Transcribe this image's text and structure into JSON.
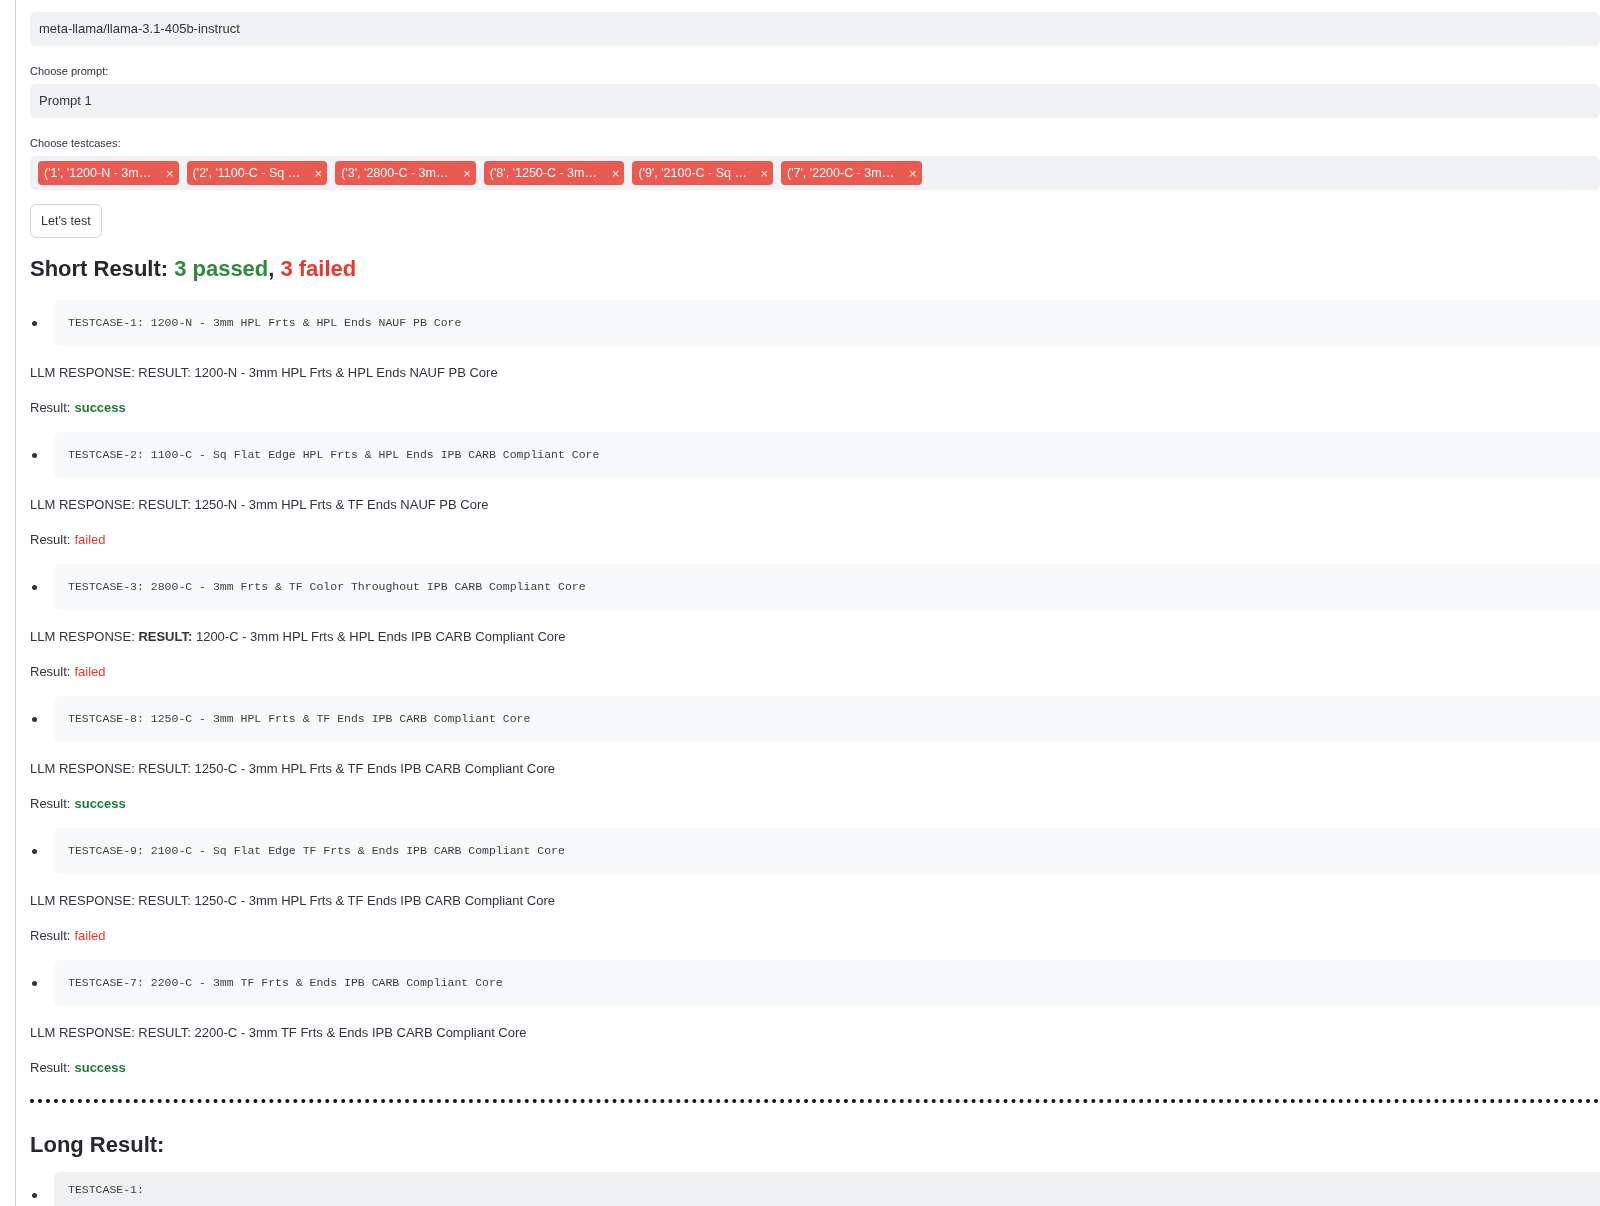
{
  "model_select": {
    "value": "meta-llama/llama-3.1-405b-instruct"
  },
  "prompt_select": {
    "label": "Choose prompt:",
    "value": "Prompt 1"
  },
  "testcase_select": {
    "label": "Choose testcases:",
    "chips": [
      {
        "label": "('1', '1200-N - 3m…",
        "remove": "×"
      },
      {
        "label": "('2', '1100-C - Sq …",
        "remove": "×"
      },
      {
        "label": "('3', '2800-C - 3m…",
        "remove": "×"
      },
      {
        "label": "('8', '1250-C - 3m…",
        "remove": "×"
      },
      {
        "label": "('9', '2100-C - Sq …",
        "remove": "×"
      },
      {
        "label": "('7', '2200-C - 3m…",
        "remove": "×"
      }
    ]
  },
  "run_button": "Let's test",
  "short_result": {
    "title": "Short Result:",
    "passed": "3 passed",
    "separator": ",",
    "failed": "3 failed"
  },
  "results": [
    {
      "testcase": "TESTCASE-1: 1200-N - 3mm HPL Frts & HPL Ends NAUF PB Core",
      "response": "LLM RESPONSE: RESULT: 1200-N - 3mm HPL Frts & HPL Ends NAUF PB Core",
      "result_label": "Result:",
      "result": "success",
      "kind": "success"
    },
    {
      "testcase": "TESTCASE-2: 1100-C - Sq Flat Edge HPL Frts & HPL Ends IPB CARB Compliant Core",
      "response": "LLM RESPONSE: RESULT: 1250-N - 3mm HPL Frts & TF Ends NAUF PB Core",
      "result_label": "Result:",
      "result": "failed",
      "kind": "failed"
    },
    {
      "testcase": "TESTCASE-3: 2800-C - 3mm Frts & TF Color Throughout IPB CARB Compliant Core",
      "response": "LLM RESPONSE: **RESULT:** 1200-C - 3mm HPL Frts & HPL Ends IPB CARB Compliant Core",
      "result_label": "Result:",
      "result": "failed",
      "kind": "failed"
    },
    {
      "testcase": "TESTCASE-8: 1250-C - 3mm HPL Frts & TF Ends IPB CARB Compliant Core",
      "response": "LLM RESPONSE: RESULT: 1250-C - 3mm HPL Frts & TF Ends IPB CARB Compliant Core",
      "result_label": "Result:",
      "result": "success",
      "kind": "success"
    },
    {
      "testcase": "TESTCASE-9: 2100-C - Sq Flat Edge TF Frts & Ends IPB CARB Compliant Core",
      "response": "LLM RESPONSE: RESULT: 1250-C - 3mm HPL Frts & TF Ends IPB CARB Compliant Core",
      "result_label": "Result:",
      "result": "failed",
      "kind": "failed"
    },
    {
      "testcase": "TESTCASE-7: 2200-C - 3mm TF Frts & Ends IPB CARB Compliant Core",
      "response": "LLM RESPONSE: RESULT: 2200-C - 3mm TF Frts & Ends IPB CARB Compliant Core",
      "result_label": "Result:",
      "result": "success",
      "kind": "success"
    }
  ],
  "long_result": {
    "title": "Long Result:",
    "first_testcase": "TESTCASE-1:"
  }
}
